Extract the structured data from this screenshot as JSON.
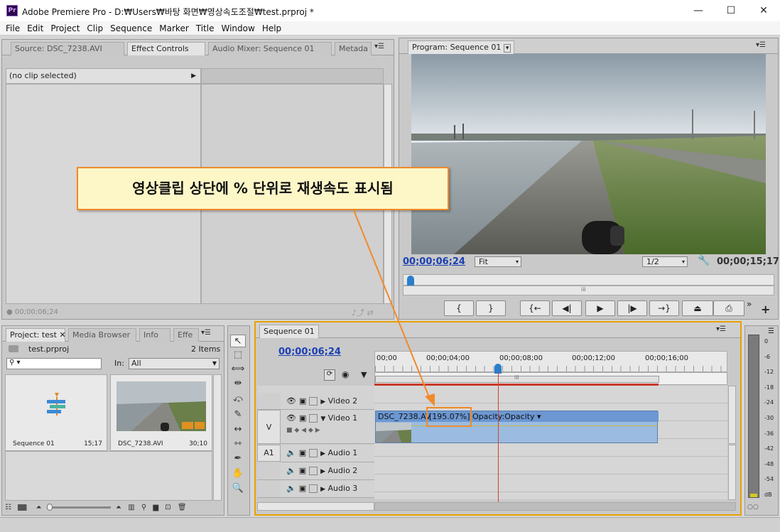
{
  "app": {
    "title": "Adobe Premiere Pro - D:₩Users₩바탕 화면₩영상속도조절₩test.prproj *",
    "icon": "Pr",
    "win_min": "—",
    "win_max": "☐",
    "win_close": "✕"
  },
  "menu": [
    "File",
    "Edit",
    "Project",
    "Clip",
    "Sequence",
    "Marker",
    "Title",
    "Window",
    "Help"
  ],
  "source_panel": {
    "tabs": [
      "Source: DSC_7238.AVI",
      "Effect Controls",
      "Audio Mixer: Sequence 01",
      "Metada"
    ],
    "no_clip": "(no clip selected)",
    "timecode": "00;00;06;24"
  },
  "program": {
    "tab": "Program: Sequence 01",
    "timecode_left": "00;00;06;24",
    "fit": "Fit",
    "resolution": "1/2",
    "timecode_right": "00;00;15;17",
    "playhead_fraction": 0.01,
    "buttons": [
      "{",
      "}",
      "{←",
      "◀|",
      "▶",
      "|▶",
      "→}",
      "⏏",
      "⎙"
    ]
  },
  "annotation": {
    "text": "영상클립 상단에 % 단위로 재생속도 표시됨"
  },
  "project": {
    "tabs": [
      "Project: test",
      "Media Browser",
      "Info",
      "Effe"
    ],
    "filename": "test.prproj",
    "items_count": "2 Items",
    "in_label": "In:",
    "in_value": "All",
    "search_placeholder": "",
    "items": [
      {
        "name": "Sequence 01",
        "duration": "15;17"
      },
      {
        "name": "DSC_7238.AVI",
        "duration": "30;10"
      }
    ]
  },
  "sequence": {
    "tab": "Sequence 01",
    "timecode": "00;00;06;24",
    "ruler": [
      "00;00",
      "00;00;04;00",
      "00;00;08;00",
      "00;00;12;00",
      "00;00;16;00"
    ],
    "tracks": {
      "video2": "Video 2",
      "video1": "Video 1",
      "audio1": "Audio 1",
      "audio2": "Audio 2",
      "audio3": "Audio 3",
      "v": "V",
      "a1": "A1"
    },
    "clip": {
      "name": "DSC_7238.AV",
      "speed": "[195.07%]",
      "opacity": "Opacity:Opacity ▾"
    }
  },
  "meter": {
    "labels": [
      "0",
      "-6",
      "-12",
      "-18",
      "-24",
      "-30",
      "-36",
      "-42",
      "-48",
      "-54",
      "dB"
    ]
  }
}
